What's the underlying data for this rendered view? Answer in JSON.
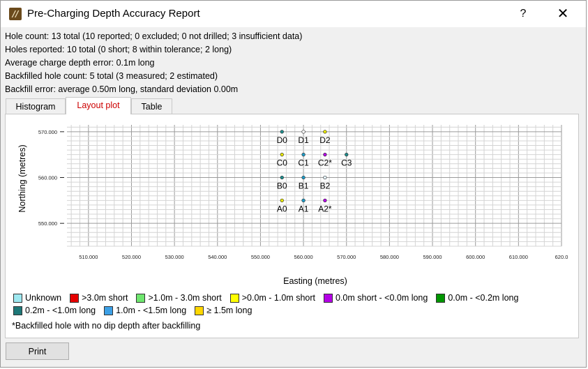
{
  "window": {
    "title": "Pre-Charging Depth Accuracy Report",
    "help_label": "?",
    "close_label": "✕",
    "app_icon_glyph": "//"
  },
  "summary": {
    "hole_count": "Hole count: 13 total (10 reported; 0 excluded; 0 not drilled; 3 insufficient data)",
    "holes_reported": "Holes reported: 10 total (0 short; 8 within tolerance; 2 long)",
    "avg_error": "Average charge depth error: 0.1m long",
    "backfilled": "Backfilled hole count: 5 total (3 measured; 2 estimated)",
    "backfill_error": "Backfill error: average 0.50m long, standard deviation 0.00m"
  },
  "tabs": [
    {
      "label": "Histogram",
      "active": false
    },
    {
      "label": "Layout plot",
      "active": true
    },
    {
      "label": "Table",
      "active": false
    }
  ],
  "chart_data": {
    "type": "scatter",
    "xlabel": "Easting (metres)",
    "ylabel": "Northing (metres)",
    "xlim": [
      505,
      620
    ],
    "ylim": [
      545,
      571.5
    ],
    "x_ticks": [
      "510.000",
      "520.000",
      "530.000",
      "540.000",
      "550.000",
      "560.000",
      "570.000",
      "580.000",
      "590.000",
      "600.000",
      "610.000",
      "620.0"
    ],
    "x_tick_values": [
      510,
      520,
      530,
      540,
      550,
      560,
      570,
      580,
      590,
      600,
      610,
      620
    ],
    "y_ticks": [
      "570.000",
      "560.000",
      "550.000"
    ],
    "y_tick_values": [
      570,
      560,
      550
    ],
    "grid": true,
    "points": [
      {
        "label": "D0",
        "x": 555,
        "y": 570,
        "color": "#1e8c8c",
        "category": "0.2m - <1.0m long"
      },
      {
        "label": "D1",
        "x": 560,
        "y": 570,
        "color": "#ffffff",
        "category": "Unknown"
      },
      {
        "label": "D2",
        "x": 565,
        "y": 570,
        "color": "#e8e800",
        "category": ">0.0m - 1.0m short"
      },
      {
        "label": "C0",
        "x": 555,
        "y": 565,
        "color": "#e8e800",
        "category": ">0.0m - 1.0m short"
      },
      {
        "label": "C1",
        "x": 560,
        "y": 565,
        "color": "#1e9cc8",
        "category": "1.0m - <1.5m long"
      },
      {
        "label": "C2*",
        "x": 565,
        "y": 565,
        "color": "#b400e6",
        "category": "0.0m short - <0.0m long"
      },
      {
        "label": "C3",
        "x": 570,
        "y": 565,
        "color": "#1e8c8c",
        "category": "0.2m - <1.0m long"
      },
      {
        "label": "B0",
        "x": 555,
        "y": 560,
        "color": "#1e8c8c",
        "category": "0.2m - <1.0m long"
      },
      {
        "label": "B1",
        "x": 560,
        "y": 560,
        "color": "#1e9cc8",
        "category": "1.0m - <1.5m long"
      },
      {
        "label": "B2",
        "x": 565,
        "y": 560,
        "color": "#e6f6ff",
        "category": "Unknown"
      },
      {
        "label": "A0",
        "x": 555,
        "y": 555,
        "color": "#e8e800",
        "category": ">0.0m - 1.0m short"
      },
      {
        "label": "A1",
        "x": 560,
        "y": 555,
        "color": "#1e9cc8",
        "category": "1.0m - <1.5m long"
      },
      {
        "label": "A2*",
        "x": 565,
        "y": 555,
        "color": "#b400e6",
        "category": "0.0m short - <0.0m long"
      }
    ]
  },
  "legend": {
    "row1": [
      {
        "label": "Unknown",
        "color": "#9ee8f0"
      },
      {
        "label": ">3.0m short",
        "color": "#e60000"
      },
      {
        "label": ">1.0m - 3.0m short",
        "color": "#6ee66e"
      },
      {
        "label": ">0.0m - 1.0m short",
        "color": "#ffff00"
      },
      {
        "label": "0.0m short - <0.0m long",
        "color": "#b400e6"
      },
      {
        "label": "0.0m - <0.2m long",
        "color": "#009600"
      }
    ],
    "row2": [
      {
        "label": "0.2m - <1.0m long",
        "color": "#1e7878"
      },
      {
        "label": "1.0m - <1.5m long",
        "color": "#3ca0e6"
      },
      {
        "label": "≥ 1.5m long",
        "color": "#ffd700"
      }
    ],
    "footnote": "*Backfilled hole with no dip depth after backfilling"
  },
  "buttons": {
    "print_label": "Print"
  }
}
